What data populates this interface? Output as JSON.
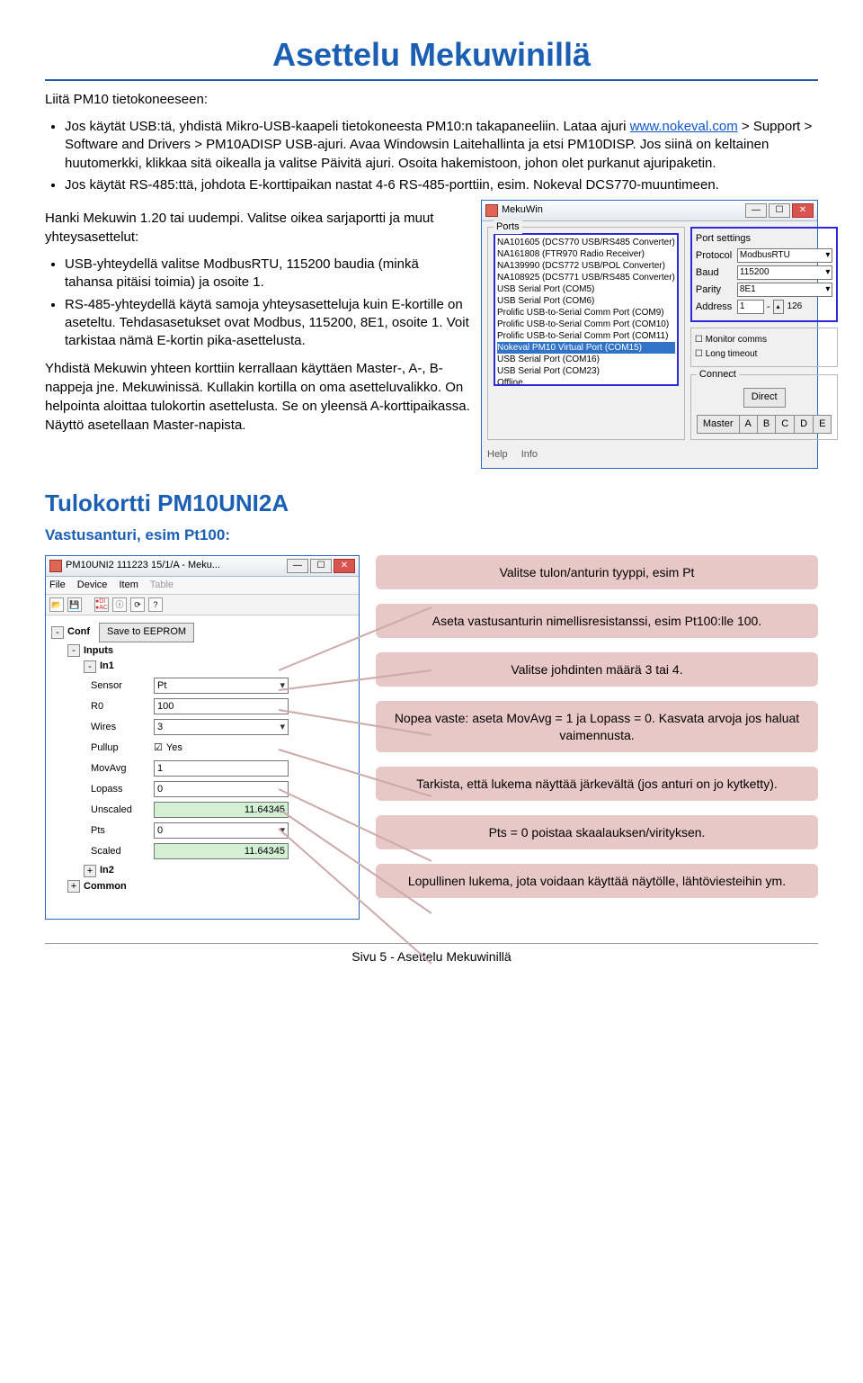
{
  "title": "Asettelu Mekuwinillä",
  "intro_lead": "Liitä PM10 tietokoneeseen:",
  "bullets_top": [
    "Jos käytät USB:tä, yhdistä Mikro-USB-kaapeli tietokoneesta PM10:n takapaneeliin. Lataa ajuri ",
    " > Support > Software and Drivers > PM10ADISP USB-ajuri. Avaa Windowsin Laitehallinta ja etsi PM10DISP. Jos siinä on keltainen huutomerkki, klikkaa sitä oikealla ja valitse Päivitä ajuri. Osoita hakemistoon, johon olet purkanut ajuripaketin.",
    "Jos käytät RS-485:ttä, johdota E-korttipaikan nastat 4-6 RS-485-porttiin, esim. Nokeval DCS770-muuntimeen."
  ],
  "link_url": "www.nokeval.com",
  "mekuwin_text": "Hanki Mekuwin 1.20 tai uudempi. Valitse oikea sarjaportti ja muut yhteysasettelut:",
  "bullets_mid": [
    "USB-yhteydellä valitse ModbusRTU, 115200 baudia (minkä tahansa pitäisi toimia) ja osoite 1.",
    "RS-485-yhteydellä käytä samoja yhteysasetteluja kuin E-kortille on aseteltu. Tehdasasetukset ovat Modbus, 115200, 8E1, osoite 1. Voit tarkistaa nämä E-kortin pika-asettelusta."
  ],
  "after_mid": "Yhdistä Mekuwin yhteen korttiin kerrallaan käyttäen Master-, A-, B-nappeja jne. Mekuwinissä. Kullakin kortilla on oma asetteluvalikko. On helpointa aloittaa tulokortin asettelusta. Se on yleensä A-korttipaikassa. Näyttö asetellaan Master-napista.",
  "section_h": "Tulokortti PM10UNI2A",
  "sub_h": "Vastusanturi, esim Pt100:",
  "mekuwin": {
    "title": "MekuWin",
    "ports_label": "Ports",
    "ports": [
      "NA101605 (DCS770 USB/RS485 Converter)",
      "NA161808 (FTR970 Radio Receiver)",
      "NA139990 (DCS772 USB/POL Converter)",
      "NA108925 (DCS771 USB/RS485 Converter)",
      "USB Serial Port (COM5)",
      "USB Serial Port (COM6)",
      "Prolific USB-to-Serial Comm Port (COM9)",
      "Prolific USB-to-Serial Comm Port (COM10)",
      "Prolific USB-to-Serial Comm Port (COM11)",
      "Nokeval PM10 Virtual Port (COM15)",
      "USB Serial Port (COM16)",
      "USB Serial Port (COM23)",
      "Offline"
    ],
    "selected_port": "Nokeval PM10 Virtual Port (COM15)",
    "portsettings_label": "Port settings",
    "protocol_l": "Protocol",
    "protocol_v": "ModbusRTU",
    "baud_l": "Baud",
    "baud_v": "115200",
    "parity_l": "Parity",
    "parity_v": "8E1",
    "address_l": "Address",
    "address_v": "1",
    "address_max": "126",
    "chk1": "Monitor comms",
    "chk2": "Long timeout",
    "connect_label": "Connect",
    "direct": "Direct",
    "btns": [
      "Master",
      "A",
      "B",
      "C",
      "D",
      "E"
    ],
    "help": "Help",
    "info": "Info"
  },
  "pm10": {
    "title": "PM10UNI2 111223 15/1/A - Meku...",
    "menu": [
      "File",
      "Device",
      "Item",
      "Table"
    ],
    "conf": "Conf",
    "save": "Save to EEPROM",
    "inputs": "Inputs",
    "in1": "In1",
    "in2": "In2",
    "common": "Common",
    "fields": {
      "sensor_l": "Sensor",
      "sensor_v": "Pt",
      "r0_l": "R0",
      "r0_v": "100",
      "wires_l": "Wires",
      "wires_v": "3",
      "pullup_l": "Pullup",
      "pullup_v": "Yes",
      "movavg_l": "MovAvg",
      "movavg_v": "1",
      "lopass_l": "Lopass",
      "lopass_v": "0",
      "unscaled_l": "Unscaled",
      "unscaled_v": "11.64345",
      "pts_l": "Pts",
      "pts_v": "0",
      "scaled_l": "Scaled",
      "scaled_v": "11.64345"
    }
  },
  "callouts": [
    "Valitse tulon/anturin tyyppi, esim Pt",
    "Aseta vastusanturin nimellisresistanssi, esim Pt100:lle 100.",
    "Valitse johdinten määrä 3 tai 4.",
    "Nopea vaste: aseta MovAvg = 1 ja Lopass = 0. Kasvata arvoja jos haluat vaimennusta.",
    "Tarkista, että lukema näyttää järkevältä (jos anturi on jo kytketty).",
    "Pts = 0 poistaa skaalauksen/virityksen.",
    "Lopullinen lukema, jota voidaan käyttää näytölle, lähtöviesteihin ym."
  ],
  "footer": "Sivu 5 - Asettelu Mekuwinillä"
}
